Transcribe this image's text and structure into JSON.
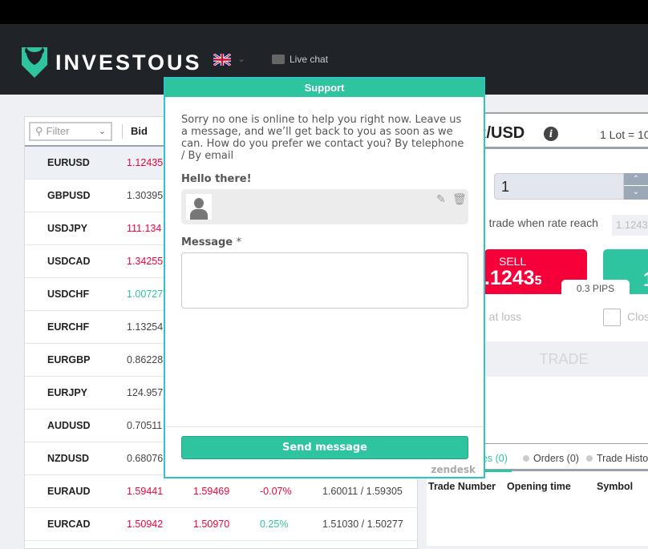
{
  "header": {
    "brand": "INVESTOUS",
    "language": "English (UK)",
    "live_chat": "Live chat"
  },
  "quotes": {
    "filter_placeholder": "Filter",
    "bid_header": "Bid",
    "rows": [
      {
        "symbol": "EURUSD",
        "bid": "1.12435",
        "bid_dir": "down"
      },
      {
        "symbol": "GBPUSD",
        "bid": "1.30395",
        "bid_dir": "none"
      },
      {
        "symbol": "USDJPY",
        "bid": "111.134",
        "bid_dir": "down"
      },
      {
        "symbol": "USDCAD",
        "bid": "1.34255",
        "bid_dir": "down"
      },
      {
        "symbol": "USDCHF",
        "bid": "1.00727",
        "bid_dir": "up"
      },
      {
        "symbol": "EURCHF",
        "bid": "1.13254",
        "bid_dir": "none"
      },
      {
        "symbol": "EURGBP",
        "bid": "0.86228",
        "bid_dir": "none"
      },
      {
        "symbol": "EURJPY",
        "bid": "124.957",
        "bid_dir": "none"
      },
      {
        "symbol": "AUDUSD",
        "bid": "0.70511",
        "bid_dir": "none"
      },
      {
        "symbol": "NZDUSD",
        "bid": "0.68076",
        "bid_dir": "none"
      },
      {
        "symbol": "EURAUD",
        "bid": "1.59441",
        "ask": "1.59469",
        "change": "-0.07%",
        "highlow": "1.60011 / 1.59305",
        "bid_dir": "down"
      },
      {
        "symbol": "EURCAD",
        "bid": "1.50942",
        "ask": "1.50970",
        "change": "0.25%",
        "highlow": "1.51030 / 1.50277",
        "bid_dir": "down"
      }
    ]
  },
  "trade": {
    "pair": "R/USD",
    "lot": "1 Lot = 10",
    "amount": "1",
    "rate_label": "n trade when rate reach",
    "rate_value": "1.1243",
    "sell_label": "SELL",
    "sell_price": ".1243",
    "sell_pip": "5",
    "buy_price": "1",
    "spread": "0.3 PIPS",
    "loss_label": "e at loss",
    "close_label": "Clos",
    "trade_button": "TRADE"
  },
  "bottom": {
    "tabs": [
      "des (0)",
      "Orders (0)",
      "Trade Histor"
    ],
    "columns": [
      "Trade Number",
      "Opening time",
      "Symbol"
    ]
  },
  "support": {
    "title": "Support",
    "intro": "Sorry no one is online to help you right now. Leave us a message, and we’ll get back to you as soon as we can. How do you prefer we contact you? By telephone / By email",
    "hello": "Hello there!",
    "message_label": "Message",
    "required": "*",
    "send": "Send message",
    "powered": "zendesk"
  },
  "colors": {
    "accent": "#2ec4a0",
    "sell": "#f6003a",
    "header": "#202328"
  }
}
